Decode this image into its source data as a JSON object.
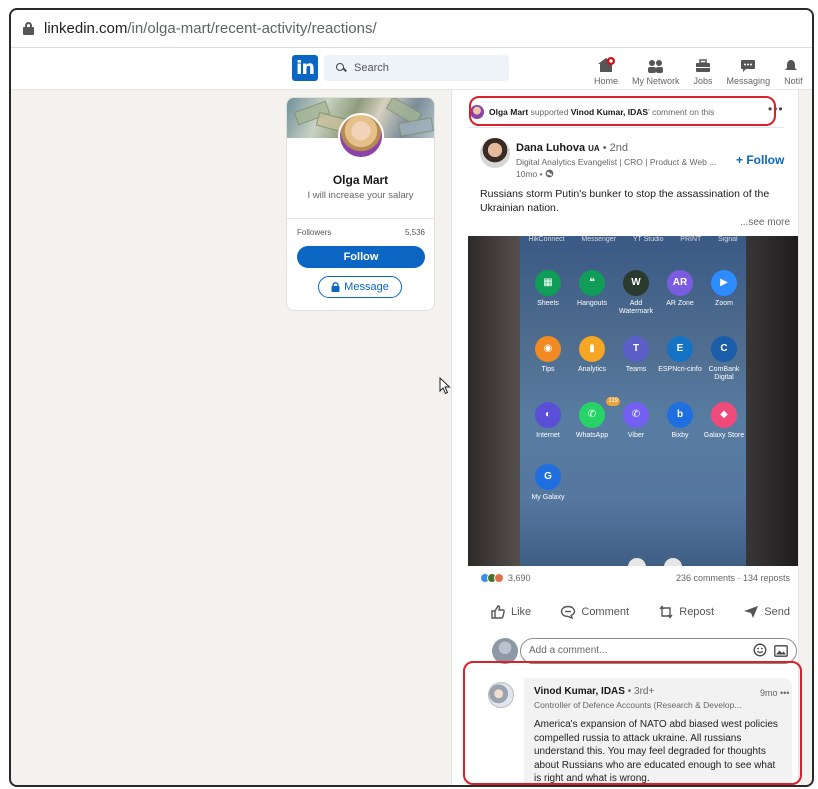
{
  "browser": {
    "url_host": "linkedin.com",
    "url_path": "/in/olga-mart/recent-activity/reactions/"
  },
  "navbar": {
    "logo_text": "in",
    "search_placeholder": "Search",
    "items": [
      {
        "label": "Home",
        "icon": "home-icon"
      },
      {
        "label": "My Network",
        "icon": "network-icon"
      },
      {
        "label": "Jobs",
        "icon": "jobs-icon"
      },
      {
        "label": "Messaging",
        "icon": "messaging-icon"
      },
      {
        "label": "Notif",
        "icon": "bell-icon"
      }
    ]
  },
  "profile": {
    "name": "Olga Mart",
    "tagline": "I will increase your salary",
    "followers_label": "Followers",
    "followers_count": "5,536",
    "follow_label": "Follow",
    "message_label": "Message"
  },
  "activity": {
    "actor": "Olga Mart",
    "verb": "supported",
    "target": "Vinod Kumar, IDAS",
    "suffix": "' comment on this"
  },
  "post": {
    "author": "Dana Luhova",
    "author_badge": "UA",
    "degree": "• 2nd",
    "headline": "Digital Analytics Evangelist | CRO | Product & Web ...",
    "time": "10mo •",
    "follow_label": "+ Follow",
    "text": "Russians storm Putin's bunker to stop the assassination of the Ukrainian nation.",
    "see_more": "...see more",
    "reaction_count": "3,690",
    "comments_reposts": "236 comments · 134 reposts",
    "actions": [
      "Like",
      "Comment",
      "Repost",
      "Send"
    ],
    "comment_placeholder": "Add a comment..."
  },
  "phone_screen": {
    "top_row": [
      "HikConnect",
      "Messenger",
      "YT Studio",
      "PRINT",
      "Signal"
    ],
    "apps": [
      {
        "label": "Sheets",
        "glyph": "▦",
        "color": "#0f9d58"
      },
      {
        "label": "Hangouts",
        "glyph": "❝",
        "color": "#0f9d58"
      },
      {
        "label": "Add Watermark",
        "glyph": "W",
        "color": "#2b3a2e"
      },
      {
        "label": "AR Zone",
        "glyph": "AR",
        "color": "#7a5ce0"
      },
      {
        "label": "Zoom",
        "glyph": "▶",
        "color": "#2d8cff"
      },
      {
        "label": "Tips",
        "glyph": "◉",
        "color": "#f28a24"
      },
      {
        "label": "Analytics",
        "glyph": "▮",
        "color": "#f6a623"
      },
      {
        "label": "Teams",
        "glyph": "T",
        "color": "#5b5fc7"
      },
      {
        "label": "ESPNcri-cinfo",
        "glyph": "E",
        "color": "#1573c6"
      },
      {
        "label": "ComBank Digital",
        "glyph": "C",
        "color": "#1a5dab"
      },
      {
        "label": "Internet",
        "glyph": "◐",
        "color": "#5a4fd6"
      },
      {
        "label": "WhatsApp",
        "glyph": "✆",
        "color": "#25d366"
      },
      {
        "label": "Viber",
        "glyph": "✆",
        "color": "#7360f2"
      },
      {
        "label": "Bixby",
        "glyph": "b",
        "color": "#1f6fe0"
      },
      {
        "label": "Galaxy Store",
        "glyph": "◆",
        "color": "#f04a7b"
      },
      {
        "label": "My Galaxy",
        "glyph": "G",
        "color": "#1f6fe0"
      }
    ],
    "whatsapp_badge": "119"
  },
  "reply": {
    "name": "Vinod Kumar, IDAS",
    "degree": "• 3rd+",
    "time": "9mo •••",
    "headline": "Controller of Defence Accounts (Research & Develop...",
    "text": "America's expansion of NATO abd biased west policies compelled russia to attack ukraine. All russians understand this. You may feel degraded for thoughts about Russians who are educated enough to see what is right and what is wrong."
  },
  "colors": {
    "brand": "#0a66c2",
    "highlight": "#d9202b",
    "page_bg": "#f4f2ee"
  }
}
